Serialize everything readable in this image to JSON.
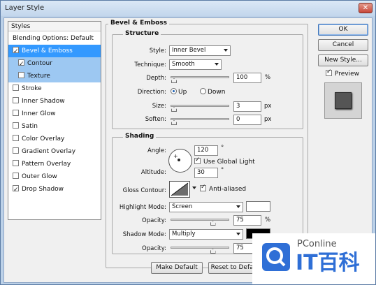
{
  "window": {
    "title": "Layer Style"
  },
  "styles": {
    "header": "Styles",
    "items": [
      {
        "label": "Blending Options: Default",
        "checkbox": false,
        "checked": false
      },
      {
        "label": "Bevel & Emboss",
        "checkbox": true,
        "checked": true
      },
      {
        "label": "Contour",
        "checkbox": true,
        "checked": true
      },
      {
        "label": "Texture",
        "checkbox": true,
        "checked": false
      },
      {
        "label": "Stroke",
        "checkbox": true,
        "checked": false
      },
      {
        "label": "Inner Shadow",
        "checkbox": true,
        "checked": false
      },
      {
        "label": "Inner Glow",
        "checkbox": true,
        "checked": false
      },
      {
        "label": "Satin",
        "checkbox": true,
        "checked": false
      },
      {
        "label": "Color Overlay",
        "checkbox": true,
        "checked": false
      },
      {
        "label": "Gradient Overlay",
        "checkbox": true,
        "checked": false
      },
      {
        "label": "Pattern Overlay",
        "checkbox": true,
        "checked": false
      },
      {
        "label": "Outer Glow",
        "checkbox": true,
        "checked": false
      },
      {
        "label": "Drop Shadow",
        "checkbox": true,
        "checked": true
      }
    ]
  },
  "bevel": {
    "title": "Bevel & Emboss",
    "structure_title": "Structure",
    "style_label": "Style:",
    "style_value": "Inner Bevel",
    "technique_label": "Technique:",
    "technique_value": "Smooth",
    "depth_label": "Depth:",
    "depth_value": "100",
    "depth_unit": "%",
    "depth_level": 0.0,
    "direction_label": "Direction:",
    "direction_up": "Up",
    "direction_down": "Down",
    "size_label": "Size:",
    "size_value": "3",
    "size_unit": "px",
    "size_level": 0.0,
    "soften_label": "Soften:",
    "soften_value": "0",
    "soften_unit": "px",
    "soften_level": 0.0
  },
  "shading": {
    "title": "Shading",
    "angle_label": "Angle:",
    "angle_value": "120",
    "angle_unit": "°",
    "global_light_label": "Use Global Light",
    "altitude_label": "Altitude:",
    "altitude_value": "30",
    "altitude_unit": "°",
    "gloss_label": "Gloss Contour:",
    "anti_aliased_label": "Anti-aliased",
    "highlight_mode_label": "Highlight Mode:",
    "highlight_mode_value": "Screen",
    "highlight_color": "#ffffff",
    "highlight_opacity_label": "Opacity:",
    "highlight_opacity_value": "75",
    "highlight_opacity_unit": "%",
    "shadow_mode_label": "Shadow Mode:",
    "shadow_mode_value": "Multiply",
    "shadow_color": "#000000",
    "shadow_opacity_label": "Opacity:",
    "shadow_opacity_value": "75"
  },
  "buttons": {
    "ok": "OK",
    "cancel": "Cancel",
    "new_style": "New Style...",
    "preview": "Preview",
    "make_default": "Make Default",
    "reset_default": "Reset to Default"
  },
  "watermark": {
    "brand": "PConline",
    "logo_text": "IT百科"
  }
}
